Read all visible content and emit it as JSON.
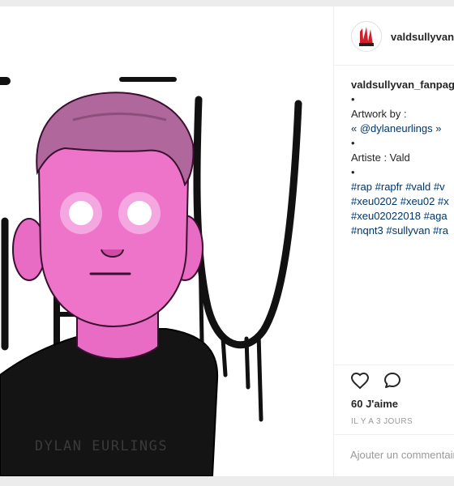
{
  "post": {
    "username": "valdsullyvan",
    "likes": "60 J'aime",
    "timestamp": "IL Y A 3 JOURS",
    "comment_placeholder": "Ajouter un commentaire..."
  },
  "media": {
    "artist_signature": "DYLAN EURLINGS",
    "background_letters": [
      "X",
      "E",
      "U"
    ]
  },
  "caption": {
    "username": "valdsullyvan_fanpage",
    "lines": [
      "•",
      "Artwork by :",
      "« @dylaneurlings »",
      "•",
      "Artiste : Vald",
      "•"
    ],
    "hashtag_lines": [
      "#rap #rapfr #vald #v",
      "#xeu0202 #xeu02 #x",
      "#xeu02022018 #aga",
      "#nqnt3 #sullyvan #ra"
    ]
  },
  "icons": {
    "like": "heart-icon",
    "comment": "comment-icon"
  },
  "colors": {
    "skin": "#e86bc4",
    "hair": "#b0679c",
    "link": "#003569",
    "text": "#262626",
    "muted": "#999999"
  }
}
